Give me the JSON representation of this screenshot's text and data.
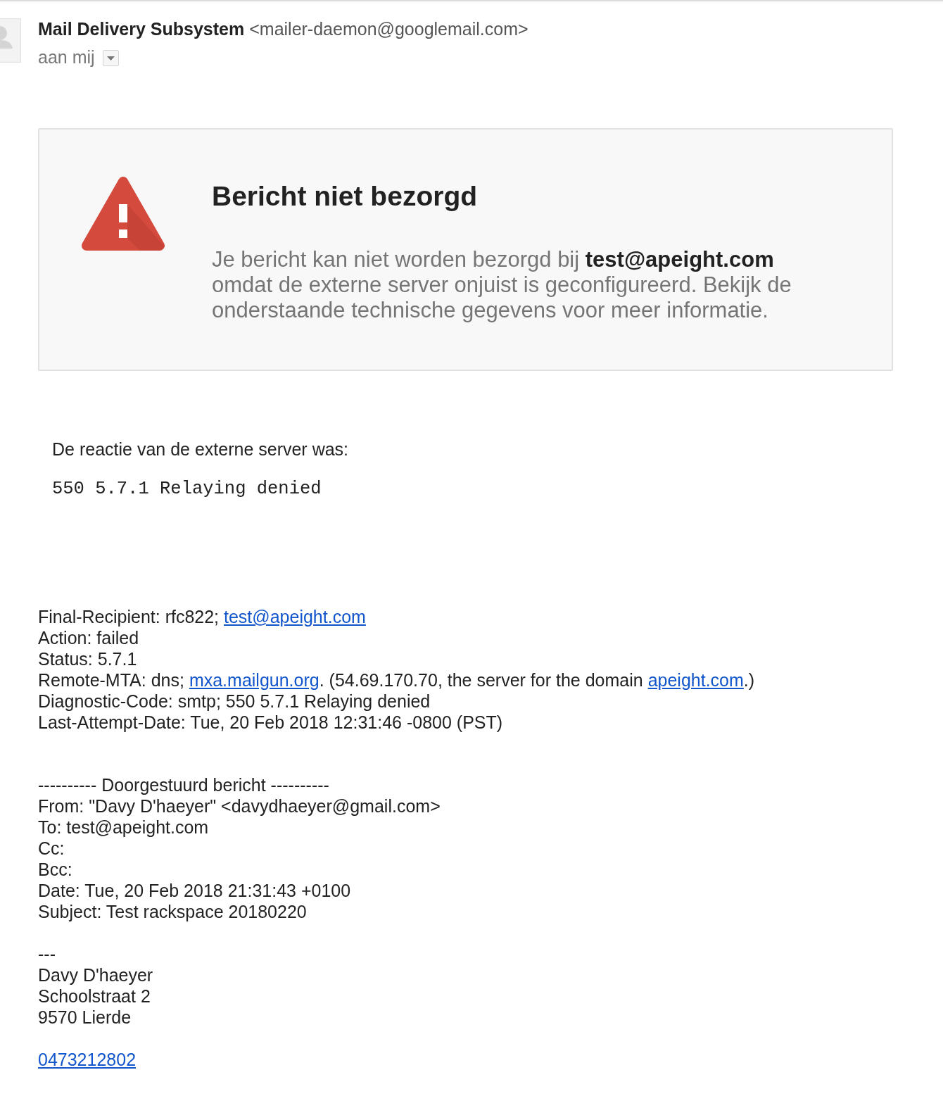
{
  "header": {
    "sender_name": "Mail Delivery Subsystem",
    "sender_email": "<mailer-daemon@googlemail.com>",
    "recipient": "aan mij"
  },
  "notice": {
    "title": "Bericht niet bezorgd",
    "message": "Je bericht kan niet worden bezorgd bij **test@apeight.com** omdat de externe server onjuist is geconfigureerd. Bekijk de onderstaande technische gegevens voor meer informatie."
  },
  "server_response": {
    "label": "De reactie van de externe server was:",
    "code": "550 5.7.1 Relaying denied"
  },
  "details": [
    {
      "parts": [
        {
          "kind": "text",
          "text": "Final-Recipient: rfc822; "
        },
        {
          "kind": "email",
          "text": "test@apeight.com"
        }
      ]
    },
    {
      "parts": [
        {
          "kind": "text",
          "text": "Action: failed"
        }
      ]
    },
    {
      "parts": [
        {
          "kind": "text",
          "text": "Status: 5.7.1"
        }
      ]
    },
    {
      "parts": [
        {
          "kind": "text",
          "text": "Remote-MTA: dns; "
        },
        {
          "kind": "domain",
          "text": "mxa.mailgun.org"
        },
        {
          "kind": "text",
          "text": ". (54.69.170.70, the server for the domain "
        },
        {
          "kind": "domain",
          "text": "apeight.com"
        },
        {
          "kind": "text",
          "text": ".)"
        }
      ]
    },
    {
      "parts": [
        {
          "kind": "text",
          "text": "Diagnostic-Code: smtp; 550 5.7.1 Relaying denied"
        }
      ]
    },
    {
      "parts": [
        {
          "kind": "text",
          "text": "Last-Attempt-Date: Tue, 20 Feb 2018 12:31:46 -0800 (PST)"
        }
      ]
    }
  ],
  "forwarded": {
    "divider": "---------- Doorgestuurd bericht ----------",
    "lines": [
      "From: \"Davy D'haeyer\" <davydhaeyer@gmail.com>",
      "To: test@apeight.com",
      "Cc:",
      "Bcc:",
      "Date: Tue, 20 Feb 2018 21:31:43 +0100",
      "Subject: Test rackspace 20180220"
    ]
  },
  "signature": {
    "separator": "---",
    "lines": [
      "Davy D'haeyer",
      "Schoolstraat 2",
      "9570 Lierde"
    ],
    "phone": "0473212802"
  }
}
